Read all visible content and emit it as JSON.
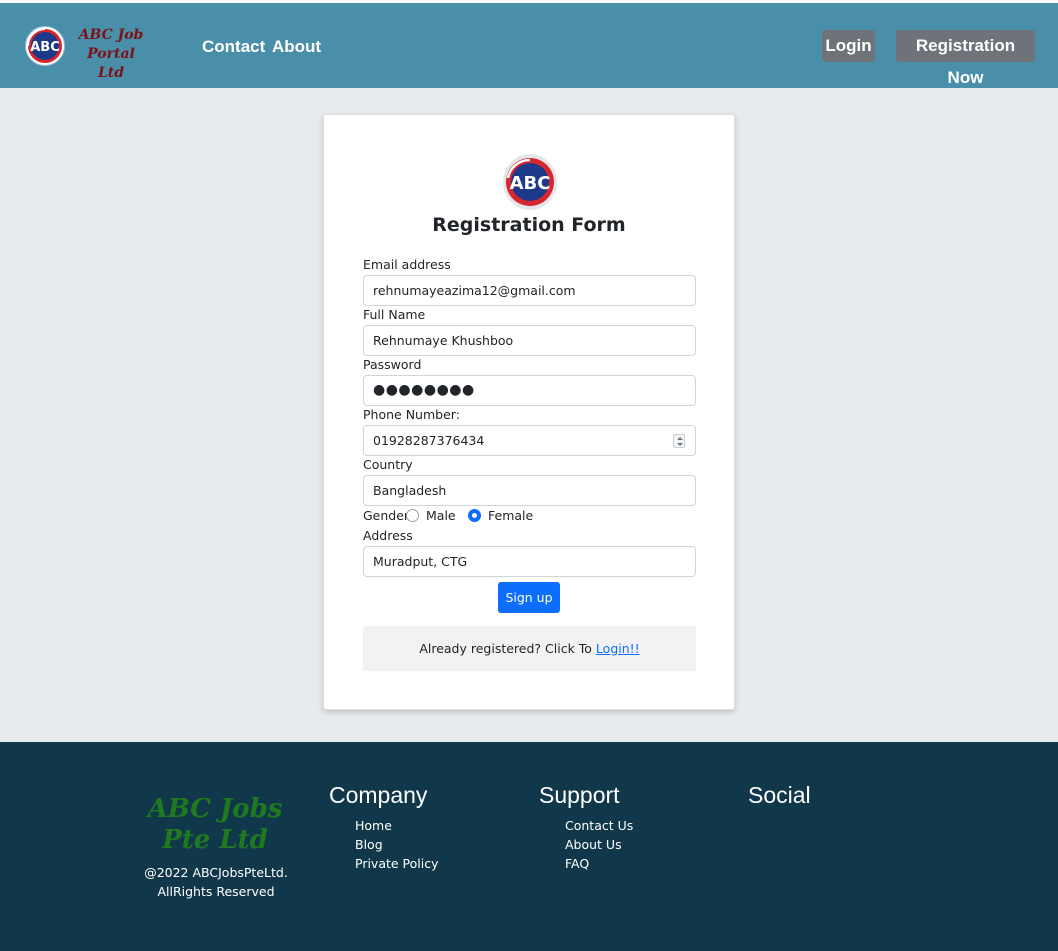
{
  "nav": {
    "brand": "ABC Job Portal Ltd",
    "logo_text": "ABC",
    "links": [
      "Contact",
      "About"
    ],
    "login_label": "Login",
    "register_label": "Registration Now"
  },
  "form": {
    "logo_text": "ABC",
    "title": "Registration Form",
    "email": {
      "label": "Email address",
      "value": "rehnumayeazima12@gmail.com"
    },
    "full_name": {
      "label": "Full Name",
      "value": "Rehnumaye Khushboo"
    },
    "password": {
      "label": "Password",
      "value": "●●●●●●●●"
    },
    "phone": {
      "label": "Phone Number:",
      "value": "01928287376434"
    },
    "country": {
      "label": "Country",
      "value": "Bangladesh"
    },
    "gender": {
      "label": "Gender",
      "options": [
        "Male",
        "Female"
      ],
      "selected": "Female"
    },
    "address": {
      "label": "Address",
      "value": "Muradput, CTG"
    },
    "submit_label": "Sign up",
    "already_text": "Already registered? Click To ",
    "login_link": "Login!!"
  },
  "footer": {
    "brand": "ABC Jobs Pte Ltd",
    "copyright": "@2022 ABCJobsPteLtd. AllRights Reserved",
    "company": {
      "title": "Company",
      "items": [
        "Home",
        "Blog",
        "Private Policy"
      ]
    },
    "support": {
      "title": "Support",
      "items": [
        "Contact Us",
        "About Us",
        "FAQ"
      ]
    },
    "social": {
      "title": "Social"
    }
  },
  "colors": {
    "navbar": "#4a8fa9",
    "footer": "#11384a",
    "primary": "#0d6efd",
    "brand_text": "#7a1218",
    "footer_brand": "#1f7a1f",
    "nav_button": "#6e737a"
  }
}
